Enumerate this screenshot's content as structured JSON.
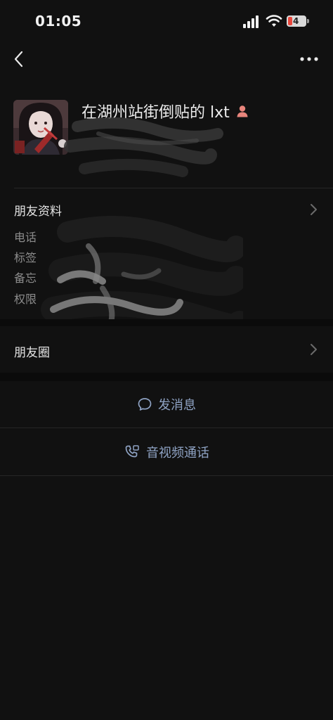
{
  "status_bar": {
    "time": "01:05",
    "battery_level": "4",
    "battery_color": "#e8473c",
    "signal_icon": "cellular-signal-icon",
    "wifi_icon": "wifi-icon",
    "battery_icon": "battery-icon"
  },
  "nav": {
    "back_icon": "chevron-left-icon",
    "more_icon": "more-dots-icon"
  },
  "profile": {
    "nickname": "在湖州站街倒贴的 lxt",
    "gender_icon": "female-icon",
    "gender_color": "#e8857c"
  },
  "friend_info": {
    "title": "朋友资料",
    "labels": [
      "电话",
      "标签",
      "备忘",
      "权限"
    ]
  },
  "moments": {
    "label": "朋友圈"
  },
  "actions": {
    "message": "发消息",
    "call": "音视频通话",
    "accent": "#8fa3c4"
  }
}
